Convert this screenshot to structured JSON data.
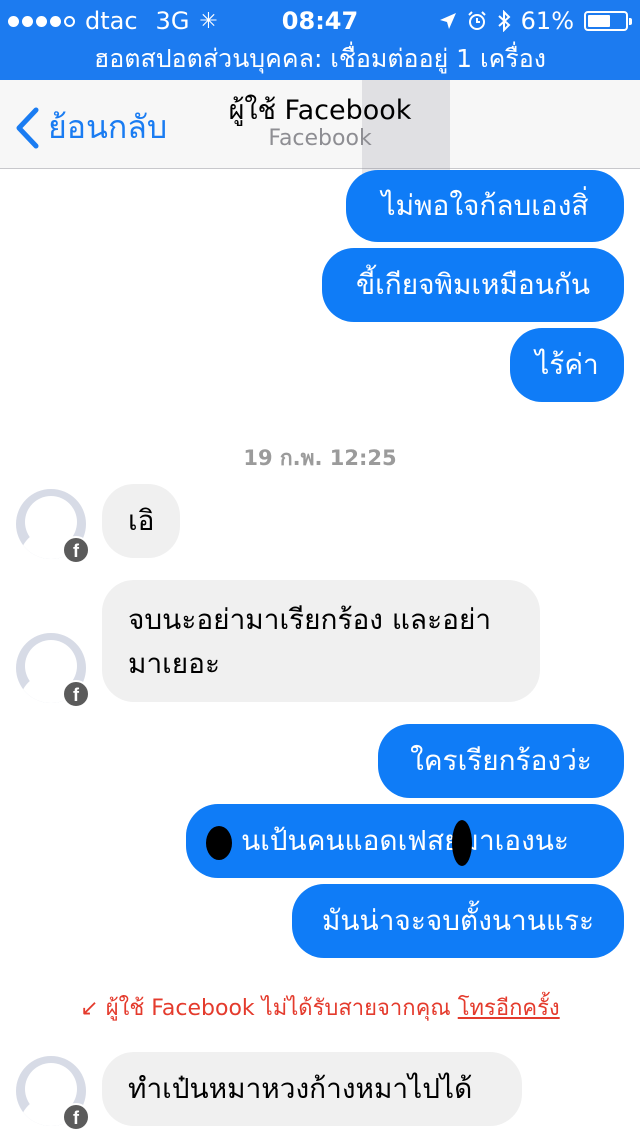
{
  "status_bar": {
    "carrier": "dtac",
    "network": "3G",
    "time": "08:47",
    "battery": "61%",
    "battery_level": 0.61,
    "icons": [
      "signal-dots",
      "activity-spinner-icon",
      "location-arrow-icon",
      "alarm-clock-icon",
      "bluetooth-icon",
      "battery-icon"
    ]
  },
  "hotspot_banner": "ฮอตสปอตส่วนบุคคล: เชื่อมต่ออยู่ 1 เครื่อง",
  "nav": {
    "back_label": "ย้อนกลับ",
    "title": "ผู้ใช้ Facebook",
    "subtitle": "Facebook"
  },
  "messages": {
    "m1": "ไม่พอใจก้ลบเองสิ่",
    "m2": "ขี้เกียจพิมเหมือนกัน",
    "m3": "ไร้ค่า",
    "timestamp": "19 ก.พ. 12:25",
    "m4": "เอิ",
    "m5": "จบนะอย่ามาเรียกร้อง และอย่ามาเยอะ",
    "m6": "ใครเรียกร้องว่ะ",
    "m7": "นเป้นคนแอดเฟสยมาเองนะ",
    "m8": "มันน่าจะจบตั้งนานแระ",
    "m9": "ทำเป๋นหมาหวงก้างหมาไปได้"
  },
  "missed_call": {
    "text": "ผู้ใช้ Facebook ไม่ได้รับสายจากคุณ",
    "link": "โทรอีกครั้ง"
  },
  "colors": {
    "accent": "#1c7bf0",
    "outgoing_bubble": "#0f7cf7",
    "incoming_bubble": "#f0f0f0",
    "missed_call": "#e43b2d"
  }
}
